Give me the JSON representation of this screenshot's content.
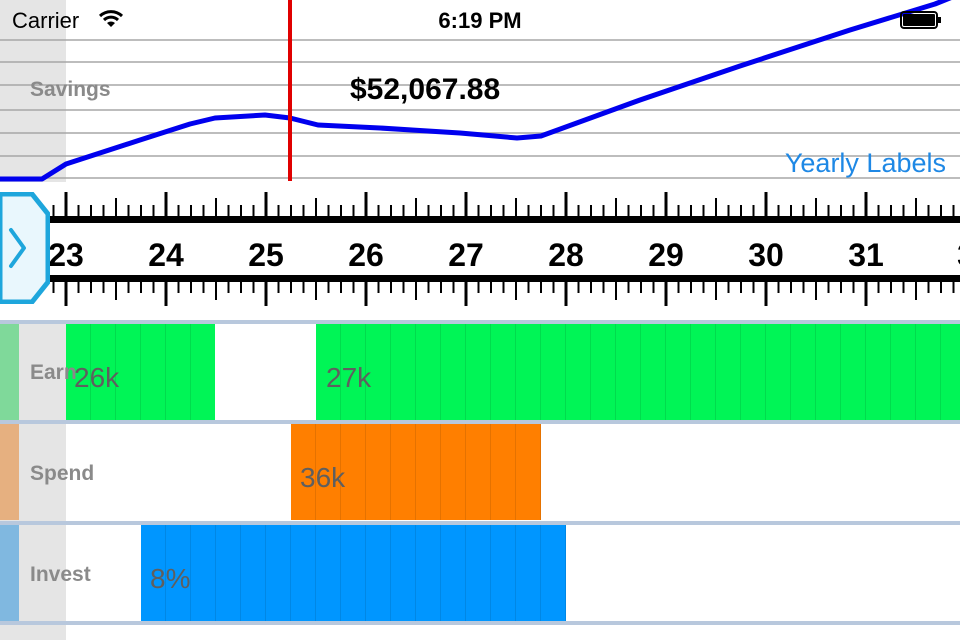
{
  "status_bar": {
    "carrier": "Carrier",
    "time": "6:19 PM"
  },
  "chart": {
    "label": "Savings",
    "value": "$52,067.88",
    "mode_button": "Yearly Labels",
    "line_color": "#0000ee",
    "cursor_color": "#e00000"
  },
  "ruler": {
    "years": [
      "23",
      "24",
      "25",
      "26",
      "27",
      "28",
      "29",
      "30",
      "31",
      "3"
    ]
  },
  "rows": {
    "earn": {
      "label": "Earn",
      "color": "#00f556",
      "swatch": "#7fd99a",
      "segments": [
        "26k",
        "27k"
      ]
    },
    "spend": {
      "label": "Spend",
      "color": "#ff7f00",
      "swatch": "#e6b080",
      "segments": [
        "36k"
      ]
    },
    "invest": {
      "label": "Invest",
      "color": "#0096ff",
      "swatch": "#80b8e0",
      "segments": [
        "8%"
      ]
    }
  }
}
